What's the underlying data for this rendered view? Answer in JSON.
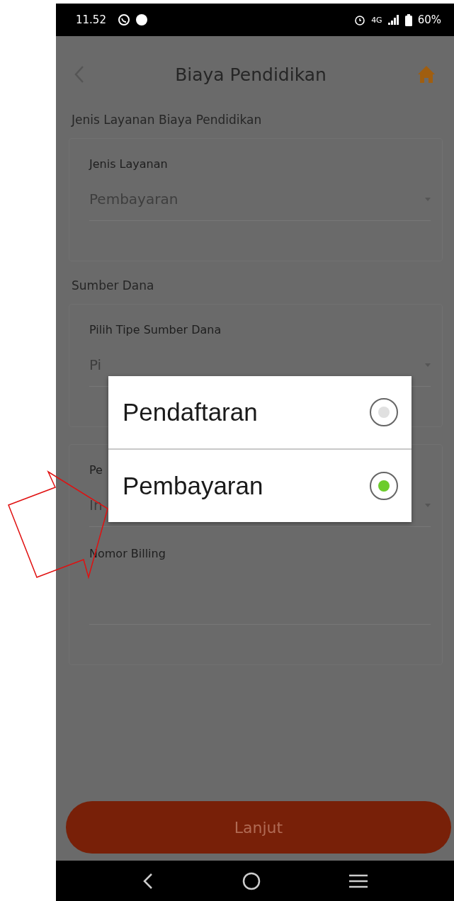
{
  "status_bar": {
    "time": "11.52",
    "network": "4G",
    "battery": "60%"
  },
  "header": {
    "title": "Biaya Pendidikan"
  },
  "sections": [
    {
      "title": "Jenis Layanan Biaya Pendidikan",
      "fields": [
        {
          "kind": "dropdown",
          "label": "Jenis Layanan",
          "value": "Pembayaran"
        }
      ]
    },
    {
      "title": "Sumber Dana",
      "fields": [
        {
          "kind": "dropdown",
          "label": "Pilih Tipe Sumber Dana",
          "value": "Pi"
        }
      ]
    },
    {
      "fields": [
        {
          "kind": "dropdown",
          "label": "Pe",
          "value": "In"
        },
        {
          "kind": "text",
          "label": "Nomor Billing"
        }
      ]
    }
  ],
  "dialog": {
    "options": [
      {
        "label": "Pendaftaran",
        "selected": false
      },
      {
        "label": "Pembayaran",
        "selected": true
      }
    ]
  },
  "button": {
    "label": "Lanjut"
  }
}
